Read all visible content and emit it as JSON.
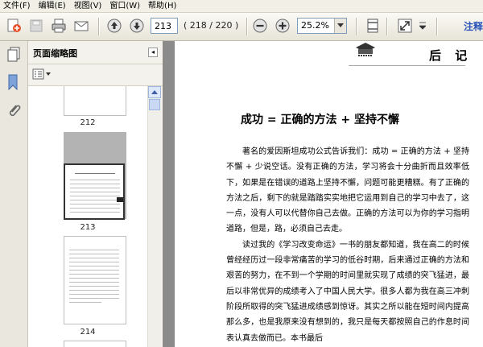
{
  "menu": [
    {
      "label": "文件(F)"
    },
    {
      "label": "编辑(E)"
    },
    {
      "label": "视图(V)"
    },
    {
      "label": "窗口(W)"
    },
    {
      "label": "帮助(H)"
    }
  ],
  "toolbar": {
    "current_page": "213",
    "page_total": "( 218 / 220 )",
    "zoom": "25.2%",
    "right_label": "注释"
  },
  "panel": {
    "title": "页面缩略图",
    "collapse_glyph": "◂",
    "thumbnails": [
      {
        "label": "212"
      },
      {
        "label": "213"
      },
      {
        "label": "214"
      }
    ]
  },
  "document": {
    "running_head": "后 记",
    "heading": "成功 = 正确的方法 + 坚持不懈",
    "paragraphs": [
      "著名的爱因斯坦成功公式告诉我们：成功 = 正确的方法 + 坚持不懈 + 少说空话。没有正确的方法，学习将会十分曲折而且效率低下，如果是在错误的道路上坚持不懈，问题可能更糟糕。有了正确的方法之后，剩下的就是踏踏实实地把它运用到自己的学习中去了，这一点，没有人可以代替你自己去做。正确的方法可以为你的学习指明道路，但是，路，必须自己去走。",
      "读过我的《学习改变命运》一书的朋友都知道，我在高二的时候曾经经历过一段非常痛苦的学习的低谷时期，后来通过正确的方法和艰苦的努力，在不到一个学期的时间里就实现了成绩的突飞猛进，最后以非常优异的成绩考入了中国人民大学。很多人都为我在高三冲刺阶段所取得的突飞猛进成绩感到惊讶。其实之所以能在短时间内提高那么多，也是我原来没有想到的，我只是每天都按照自己的作息时间表认真去做而已。本书最后"
    ]
  }
}
